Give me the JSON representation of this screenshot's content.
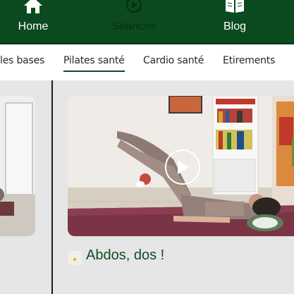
{
  "nav": {
    "items": [
      {
        "label": "Home",
        "icon": "home-icon",
        "active": false
      },
      {
        "label": "Séances",
        "icon": "play-circle-icon",
        "active": true
      },
      {
        "label": "Blog",
        "icon": "book-icon",
        "active": false
      }
    ]
  },
  "tabs": [
    {
      "label": "les bases",
      "active": false
    },
    {
      "label": "Pilates santé",
      "active": true
    },
    {
      "label": "Cardio santé",
      "active": false
    },
    {
      "label": "Etirements",
      "active": false
    }
  ],
  "cards": [
    {
      "title": "Abdos, dos !"
    }
  ],
  "colors": {
    "brand_green": "#0b4a1f",
    "title_green": "#0d4d22",
    "background": "#e6e6e6"
  }
}
